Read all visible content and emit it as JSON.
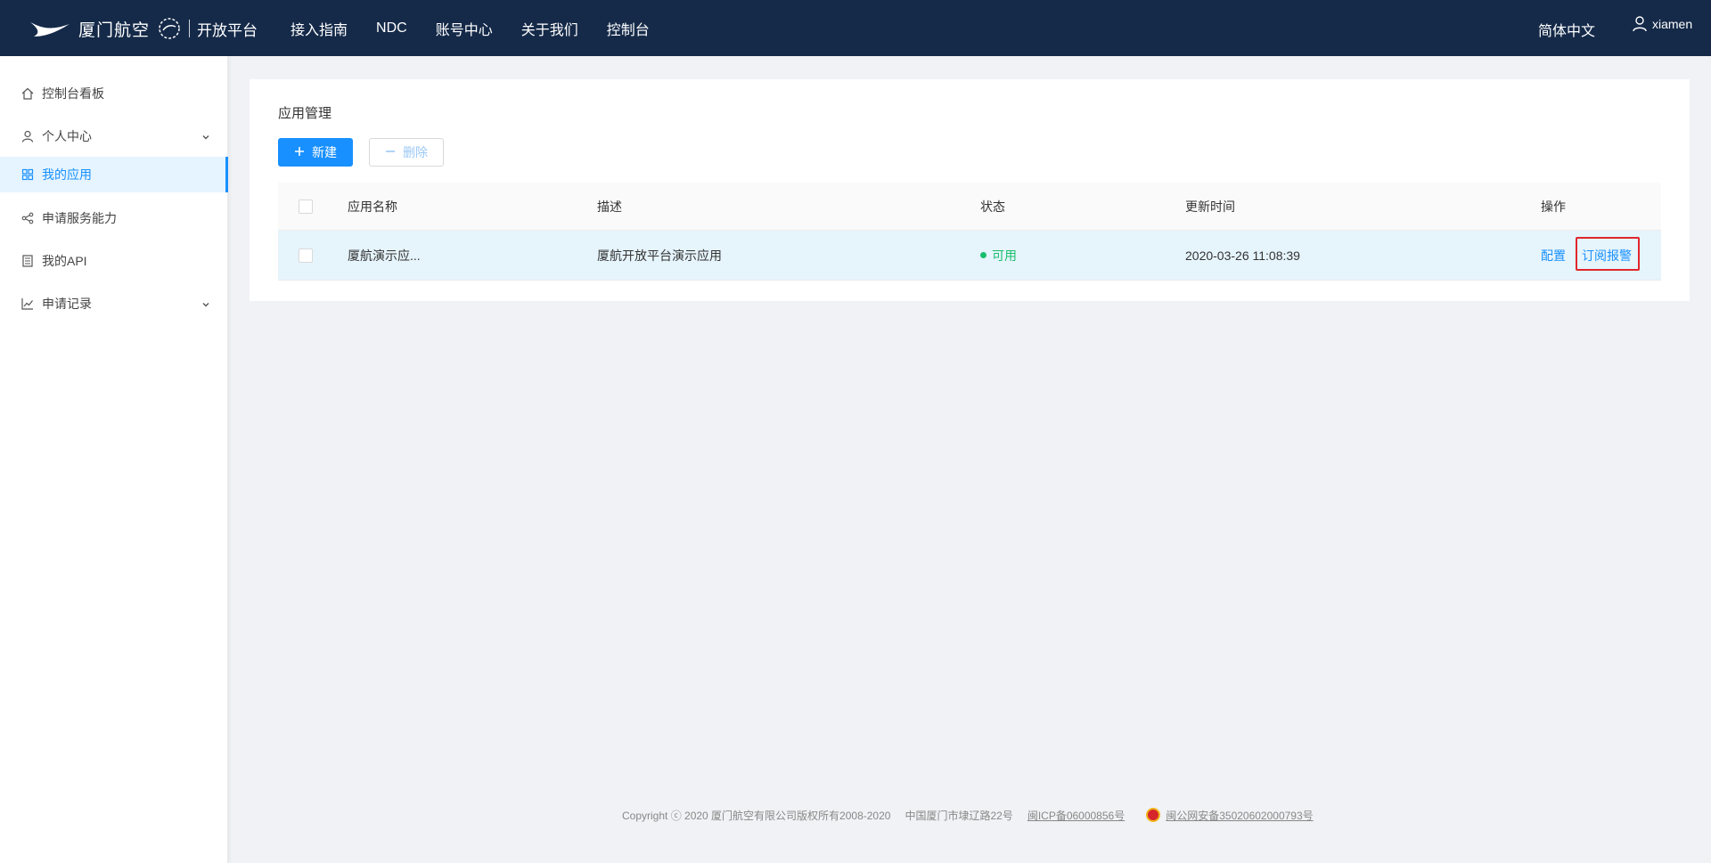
{
  "header": {
    "brand": "厦门航空",
    "platform": "开放平台",
    "nav": [
      "接入指南",
      "NDC",
      "账号中心",
      "关于我们",
      "控制台"
    ],
    "language": "简体中文",
    "username": "xiamen"
  },
  "sidebar": {
    "items": [
      {
        "label": "控制台看板",
        "icon": "home-icon"
      },
      {
        "label": "个人中心",
        "icon": "user-icon",
        "expandable": true
      },
      {
        "label": "我的应用",
        "icon": "apps-icon",
        "active": true
      },
      {
        "label": "申请服务能力",
        "icon": "share-icon"
      },
      {
        "label": "我的API",
        "icon": "document-icon"
      },
      {
        "label": "申请记录",
        "icon": "chart-line-icon",
        "expandable": true
      }
    ]
  },
  "main": {
    "title": "应用管理",
    "new_button": "新建",
    "delete_button": "删除",
    "table": {
      "headers": [
        "应用名称",
        "描述",
        "状态",
        "更新时间",
        "操作"
      ],
      "rows": [
        {
          "name": "厦航演示应...",
          "description": "厦航开放平台演示应用",
          "status": "可用",
          "updated": "2020-03-26 11:08:39",
          "actions": [
            "配置",
            "订阅报警"
          ]
        }
      ]
    }
  },
  "footer": {
    "copyright": "Copyright ⓒ 2020 厦门航空有限公司版权所有2008-2020",
    "address": "中国厦门市埭辽路22号",
    "icp": "闽ICP备06000856号",
    "police": "闽公网安备35020602000793号"
  },
  "colors": {
    "header_bg": "#152a49",
    "accent": "#1890ff",
    "status_ok": "#19be6b",
    "highlight": "#e0262d"
  }
}
